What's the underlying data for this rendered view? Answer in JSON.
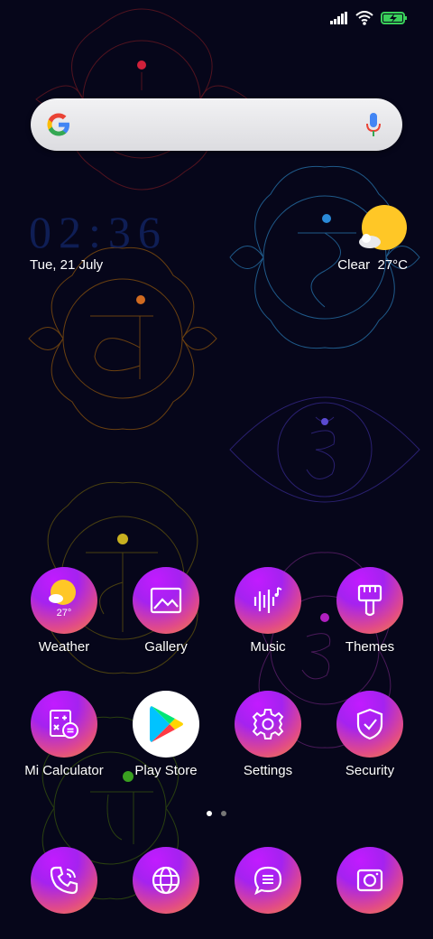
{
  "clock": {
    "time": "02:36",
    "date": "Tue, 21 July"
  },
  "weather_widget": {
    "condition": "Clear",
    "temperature": "27°C",
    "icon": "sun-cloud-icon"
  },
  "status_bar": {
    "icons": [
      "signal-icon",
      "wifi-icon",
      "battery-charging-icon"
    ]
  },
  "search": {
    "icon": "google-g-icon",
    "mic_icon": "mic-icon"
  },
  "apps": [
    {
      "label": "Weather",
      "icon": "weather-icon",
      "badge": "27°"
    },
    {
      "label": "Gallery",
      "icon": "gallery-icon"
    },
    {
      "label": "Music",
      "icon": "music-icon"
    },
    {
      "label": "Themes",
      "icon": "brush-icon"
    },
    {
      "label": "Mi Calculator",
      "icon": "calculator-icon"
    },
    {
      "label": "Play Store",
      "icon": "play-store-icon"
    },
    {
      "label": "Settings",
      "icon": "gear-icon"
    },
    {
      "label": "Security",
      "icon": "shield-icon"
    }
  ],
  "page_indicator": {
    "pages": 2,
    "current": 1
  },
  "dock": [
    {
      "name": "phone",
      "icon": "phone-icon"
    },
    {
      "name": "browser",
      "icon": "globe-icon"
    },
    {
      "name": "messages",
      "icon": "message-icon"
    },
    {
      "name": "camera",
      "icon": "camera-icon"
    }
  ],
  "colors": {
    "background": "#06061a",
    "icon_gradient_top": "#c21bff",
    "icon_gradient_bottom": "#f5883a",
    "clock": "#0f1e55"
  }
}
